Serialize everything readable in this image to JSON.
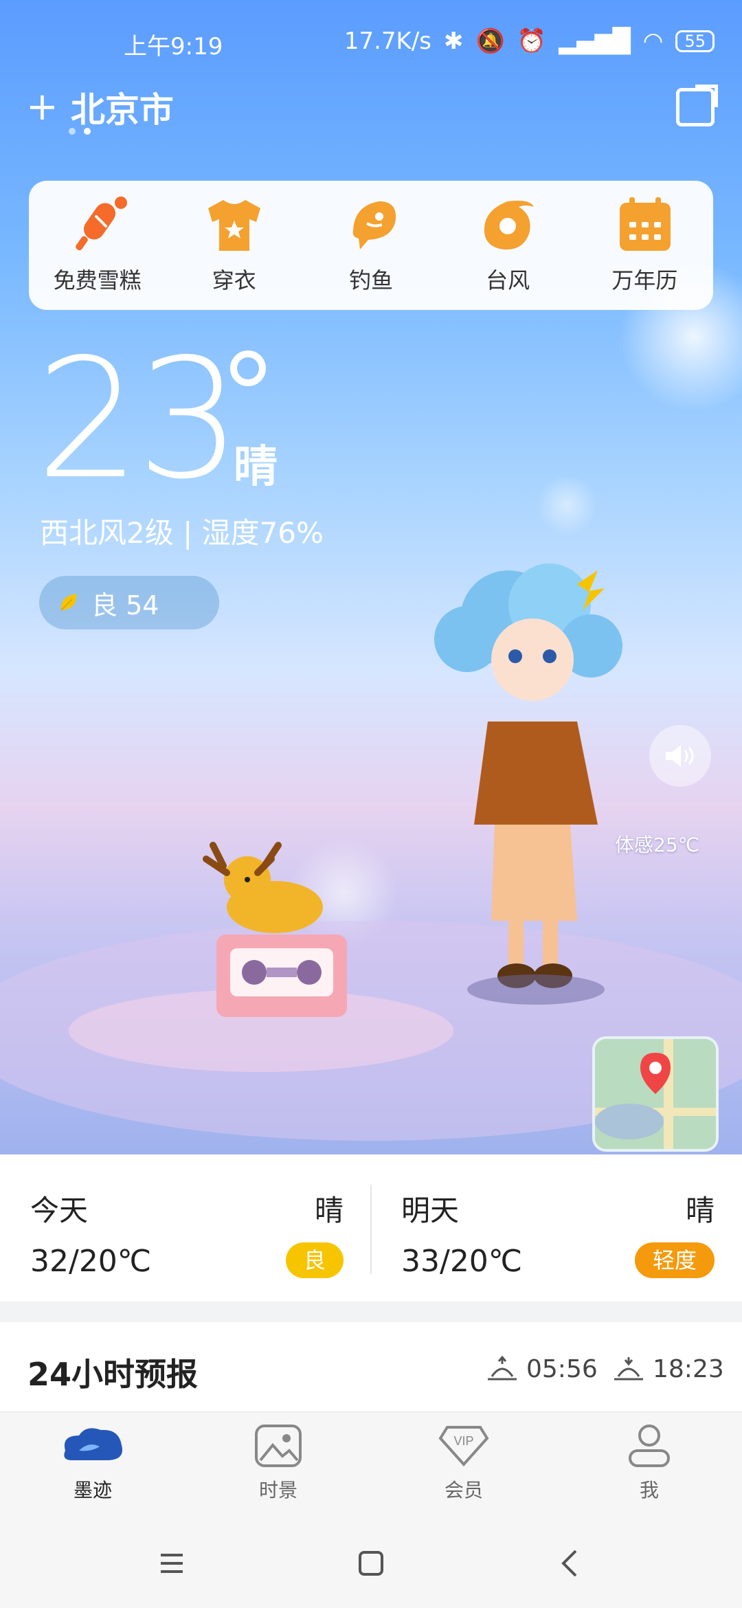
{
  "status": {
    "time": "上午9:19",
    "speed": "17.7K/s",
    "battery": "55"
  },
  "header": {
    "add_label": "+",
    "city": "北京市"
  },
  "quick_actions": [
    {
      "label": "免费雪糕",
      "icon": "popsicle-icon"
    },
    {
      "label": "穿衣",
      "icon": "shirt-icon"
    },
    {
      "label": "钓鱼",
      "icon": "fish-icon"
    },
    {
      "label": "台风",
      "icon": "typhoon-icon"
    },
    {
      "label": "万年历",
      "icon": "calendar-icon"
    }
  ],
  "weather": {
    "temperature": "23",
    "condition": "晴",
    "wind_humidity": "西北风2级 | 湿度76%",
    "aqi": "良 54",
    "feels_like": "体感25℃"
  },
  "days": [
    {
      "label": "今天",
      "condition": "晴",
      "range": "32/20℃",
      "aqi": "良",
      "aqi_color": "#f7c400"
    },
    {
      "label": "明天",
      "condition": "晴",
      "range": "33/20℃",
      "aqi": "轻度",
      "aqi_color": "#f49a0c"
    }
  ],
  "forecast": {
    "title": "24小时预报",
    "sunrise": "05:56",
    "sunset": "18:23"
  },
  "tabs": [
    {
      "label": "墨迹",
      "icon": "moji-logo-icon",
      "active": true
    },
    {
      "label": "时景",
      "icon": "photo-icon",
      "active": false
    },
    {
      "label": "会员",
      "icon": "vip-icon",
      "active": false
    },
    {
      "label": "我",
      "icon": "user-icon",
      "active": false
    }
  ],
  "colors": {
    "accent_orange": "#f4a12f",
    "popsicle_red": "#f46b2a",
    "tab_active_blue": "#2457b8"
  }
}
